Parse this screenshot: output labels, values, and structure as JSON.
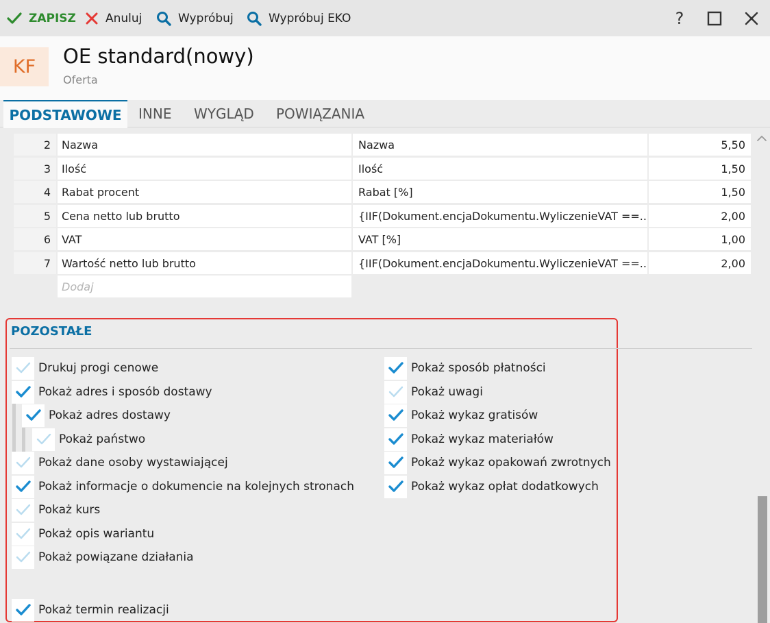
{
  "toolbar": {
    "save_label": "ZAPISZ",
    "cancel_label": "Anuluj",
    "try_label": "Wypróbuj",
    "try_eko_label": "Wypróbuj EKO",
    "help_label": "?"
  },
  "header": {
    "avatar_text": "KF",
    "title": "OE standard(nowy)",
    "subtitle": "Oferta"
  },
  "tabs": [
    {
      "label": "PODSTAWOWE",
      "active": true
    },
    {
      "label": "INNE",
      "active": false
    },
    {
      "label": "WYGLĄD",
      "active": false
    },
    {
      "label": "POWIĄZANIA",
      "active": false
    }
  ],
  "grid": {
    "rows": [
      {
        "num": "2",
        "name": "Nazwa",
        "expr": "Nazwa",
        "width": "5,50"
      },
      {
        "num": "3",
        "name": "Ilość",
        "expr": "Ilość",
        "width": "1,50"
      },
      {
        "num": "4",
        "name": "Rabat procent",
        "expr": "Rabat [%]",
        "width": "1,50"
      },
      {
        "num": "5",
        "name": "Cena netto lub brutto",
        "expr": "{IIF(Dokument.encjaDokumentu.WyliczenieVAT ==...",
        "width": "2,00"
      },
      {
        "num": "6",
        "name": "VAT",
        "expr": "VAT [%]",
        "width": "1,00"
      },
      {
        "num": "7",
        "name": "Wartość netto lub brutto",
        "expr": "{IIF(Dokument.encjaDokumentu.WyliczenieVAT ==...",
        "width": "2,00"
      }
    ],
    "add_placeholder": "Dodaj"
  },
  "section": {
    "title": "POZOSTAŁE",
    "left": [
      {
        "label": "Drukuj progi cenowe",
        "checked": false
      },
      {
        "label": "Pokaż adres i sposób dostawy",
        "checked": true
      },
      {
        "label": "Pokaż adres dostawy",
        "checked": true
      },
      {
        "label": "Pokaż państwo",
        "checked": false
      },
      {
        "label": "Pokaż dane osoby wystawiającej",
        "checked": false
      },
      {
        "label": "Pokaż informacje o dokumencie na kolejnych stronach",
        "checked": true
      },
      {
        "label": "Pokaż kurs",
        "checked": false
      },
      {
        "label": "Pokaż opis wariantu",
        "checked": false
      },
      {
        "label": "Pokaż powiązane działania",
        "checked": false
      },
      {
        "label": "Pokaż termin realizacji",
        "checked": true
      }
    ],
    "right": [
      {
        "label": "Pokaż sposób płatności",
        "checked": true
      },
      {
        "label": "Pokaż uwagi",
        "checked": false
      },
      {
        "label": "Pokaż wykaz gratisów",
        "checked": true
      },
      {
        "label": "Pokaż wykaz materiałów",
        "checked": true
      },
      {
        "label": "Pokaż wykaz opakowań zwrotnych",
        "checked": true
      },
      {
        "label": "Pokaż wykaz opłat dodatkowych",
        "checked": true
      }
    ]
  },
  "colors": {
    "accent": "#0b6fa4",
    "save_green": "#2e8b2e",
    "cancel_red": "#e53935",
    "check_blue": "#1a8cd0",
    "check_unchecked": "#b9dcef",
    "avatar_bg": "#fbe9dc",
    "avatar_text": "#e06e2a",
    "highlight_border": "#e53935"
  }
}
